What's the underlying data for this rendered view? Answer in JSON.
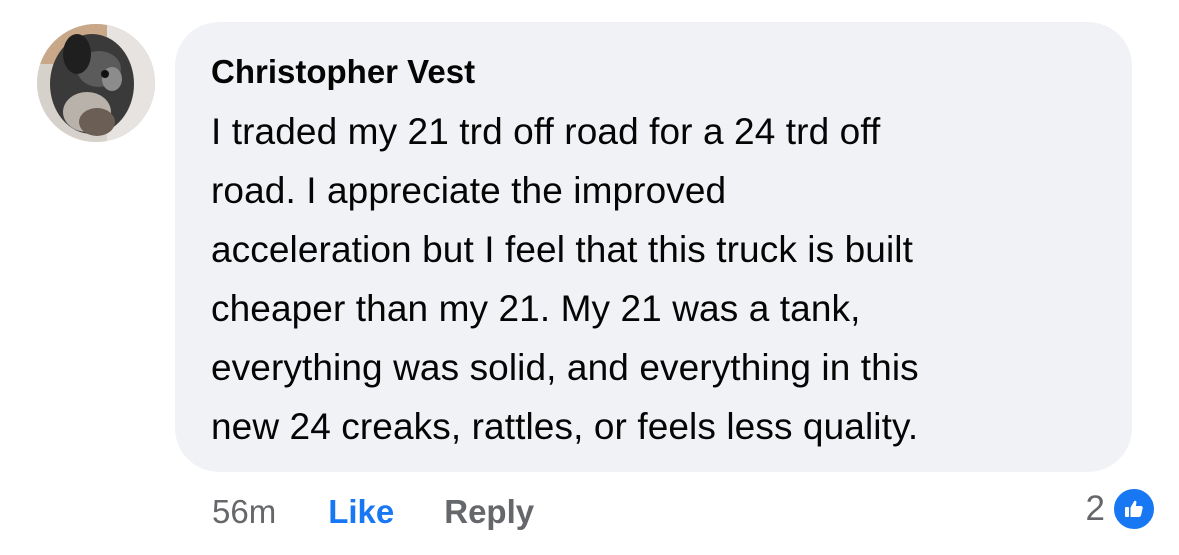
{
  "comment": {
    "author": "Christopher Vest",
    "text": "I traded my 21 trd off road for a 24 trd off\nroad. I appreciate the improved\nacceleration but I feel that this truck is built\ncheaper than my 21. My 21 was a tank,\neverything was solid, and everything in this\nnew 24 creaks, rattles, or feels less quality.",
    "time": "56m",
    "like_label": "Like",
    "reply_label": "Reply",
    "reaction_count": "2",
    "reaction_icon": "thumbs-up-icon"
  },
  "colors": {
    "bubble_bg": "#f0f2f5",
    "text": "#050505",
    "meta": "#65676b",
    "accent": "#1877f2"
  }
}
